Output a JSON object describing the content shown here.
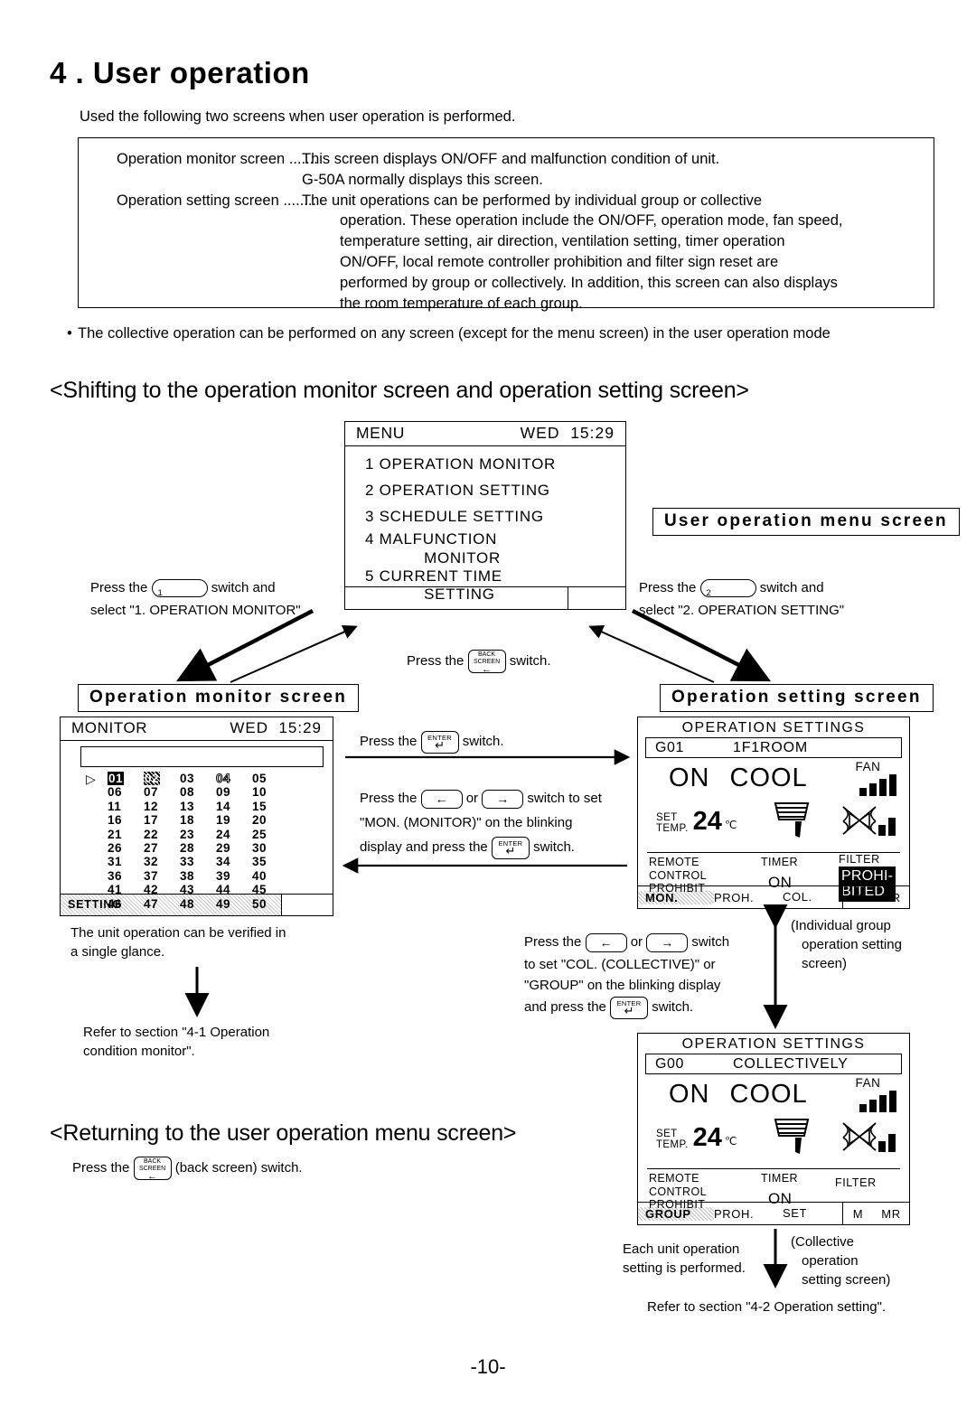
{
  "chapter": {
    "number": "4 .",
    "title": "User operation"
  },
  "intro": "Used the following two screens when user operation is performed.",
  "description_box": {
    "rows": [
      {
        "label": "Operation monitor screen .......",
        "text": "This screen displays ON/OFF and malfunction condition of unit."
      },
      {
        "label": "",
        "text": "G-50A normally displays  this screen."
      },
      {
        "label": "Operation setting screen ........",
        "text": "The unit operations can be performed by individual group or collective"
      }
    ],
    "continuation": [
      "operation. These operation include the ON/OFF, operation mode, fan speed,",
      "temperature setting, air direction, ventilation setting, timer operation",
      "ON/OFF, local remote controller prohibition and filter sign reset are",
      "performed by group or collectively. In addition, this screen can also displays",
      "the room temperature of each group."
    ]
  },
  "bullet": "The collective operation can be performed on any screen (except for the menu screen) in the user operation mode",
  "sections": {
    "shifting": "<Shifting to the operation monitor screen and operation setting screen>",
    "returning": "<Returning to the user operation menu screen>"
  },
  "menu_screen": {
    "title": "MENU",
    "day": "WED",
    "time": "15:29",
    "items": [
      "1 OPERATION MONITOR",
      "2 OPERATION SETTING",
      "3 SCHEDULE SETTING",
      "4 MALFUNCTION",
      "            MONITOR",
      "5 CURRENT TIME",
      "            SETTING"
    ]
  },
  "captions": {
    "user_menu": "User operation menu screen",
    "monitor": "Operation monitor screen",
    "setting": "Operation setting screen"
  },
  "instructions": {
    "press_1_line1": "Press the",
    "press_1_key": "1",
    "press_1_line1b": "switch and",
    "press_1_line2": "select \"1. OPERATION MONITOR\"",
    "press_2_line1": "Press the",
    "press_2_key": "2",
    "press_2_line1b": "switch and",
    "press_2_line2": "select \"2. OPERATION SETTING\"",
    "back_screen_press": "Press the",
    "back_screen_after": "switch.",
    "enter_press": "Press the",
    "enter_after": "switch.",
    "mon_line1a": "Press the",
    "mon_line1b": "or",
    "mon_line1c": "switch to set",
    "mon_line2": "\"MON. (MONITOR)\" on the blinking",
    "mon_line3a": "display and press the",
    "mon_line3b": "switch.",
    "col_line1a": "Press the",
    "col_line1b": "or",
    "col_line1c": "switch",
    "col_line2": "to set \"COL. (COLLECTIVE)\" or",
    "col_line3": "\"GROUP\" on the blinking display",
    "col_line4a": "and press the",
    "col_line4b": "switch.",
    "verify_l1": "The unit operation can be verified in",
    "verify_l2": "a single glance.",
    "refer41_l1": "Refer to section \"4-1 Operation",
    "refer41_l2": "condition monitor\".",
    "individual_note_l1": "(Individual group",
    "individual_note_l2": "operation setting",
    "individual_note_l3": "screen)",
    "collective_note_l1": "(Collective",
    "collective_note_l2": "operation",
    "collective_note_l3": "setting screen)",
    "each_unit_l1": "Each unit operation",
    "each_unit_l2": "setting is performed.",
    "refer42": "Refer to section \"4-2 Operation setting\".",
    "returning_press_a": "Press the",
    "returning_press_b": "(back screen) switch."
  },
  "keys": {
    "enter_label": "ENTER",
    "enter_symbol": "↵",
    "back_l1": "BACK",
    "back_l2": "SCREEN",
    "back_symbol": "←",
    "left_arrow": "←",
    "right_arrow": "→"
  },
  "monitor_screen": {
    "title": "MONITOR",
    "day": "WED",
    "time": "15:29",
    "caret": "▷",
    "cells": [
      {
        "v": "01",
        "style": "inv"
      },
      {
        "v": "02",
        "style": "hatch"
      },
      {
        "v": "03",
        "style": "plain"
      },
      {
        "v": "04",
        "style": "outline"
      },
      {
        "v": "05",
        "style": "plain"
      },
      {
        "v": "06",
        "style": "plain"
      },
      {
        "v": "07",
        "style": "plain"
      },
      {
        "v": "08",
        "style": "plain"
      },
      {
        "v": "09",
        "style": "plain"
      },
      {
        "v": "10",
        "style": "plain"
      },
      {
        "v": "11",
        "style": "plain"
      },
      {
        "v": "12",
        "style": "plain"
      },
      {
        "v": "13",
        "style": "plain"
      },
      {
        "v": "14",
        "style": "plain"
      },
      {
        "v": "15",
        "style": "plain"
      },
      {
        "v": "16",
        "style": "plain"
      },
      {
        "v": "17",
        "style": "plain"
      },
      {
        "v": "18",
        "style": "plain"
      },
      {
        "v": "19",
        "style": "plain"
      },
      {
        "v": "20",
        "style": "plain"
      },
      {
        "v": "21",
        "style": "plain"
      },
      {
        "v": "22",
        "style": "plain"
      },
      {
        "v": "23",
        "style": "plain"
      },
      {
        "v": "24",
        "style": "plain"
      },
      {
        "v": "25",
        "style": "plain"
      },
      {
        "v": "26",
        "style": "plain"
      },
      {
        "v": "27",
        "style": "plain"
      },
      {
        "v": "28",
        "style": "plain"
      },
      {
        "v": "29",
        "style": "plain"
      },
      {
        "v": "30",
        "style": "plain"
      },
      {
        "v": "31",
        "style": "plain"
      },
      {
        "v": "32",
        "style": "plain"
      },
      {
        "v": "33",
        "style": "plain"
      },
      {
        "v": "34",
        "style": "plain"
      },
      {
        "v": "35",
        "style": "plain"
      },
      {
        "v": "36",
        "style": "plain"
      },
      {
        "v": "37",
        "style": "plain"
      },
      {
        "v": "38",
        "style": "plain"
      },
      {
        "v": "39",
        "style": "plain"
      },
      {
        "v": "40",
        "style": "plain"
      },
      {
        "v": "41",
        "style": "plain"
      },
      {
        "v": "42",
        "style": "plain"
      },
      {
        "v": "43",
        "style": "plain"
      },
      {
        "v": "44",
        "style": "plain"
      },
      {
        "v": "45",
        "style": "plain"
      },
      {
        "v": "46",
        "style": "plain"
      },
      {
        "v": "47",
        "style": "plain"
      },
      {
        "v": "48",
        "style": "plain"
      },
      {
        "v": "49",
        "style": "plain"
      },
      {
        "v": "50",
        "style": "plain"
      }
    ],
    "footer_setting": "SETTING"
  },
  "ops_individual": {
    "header": "OPERATION  SETTINGS",
    "group_id": "G01",
    "group_name": "1F1ROOM",
    "power": "ON",
    "mode": "COOL",
    "fan_label": "FAN",
    "fan_bars": 4,
    "set_temp_label_1": "SET",
    "set_temp_label_2": "TEMP.",
    "set_temp_value": "24",
    "set_temp_unit": "℃",
    "vent_bars": 2,
    "remote_l1": "REMOTE",
    "remote_l2": "CONTROL",
    "remote_l3": "PROHIBIT",
    "timer_label": "TIMER",
    "timer_value": "ON",
    "filter_label": "FILTER",
    "filter_badge_l1": "PROHI-",
    "filter_badge_l2": "BITED",
    "footer": [
      "MON.",
      "PROH.",
      "COL.",
      "M",
      "MR"
    ]
  },
  "ops_collective": {
    "header": "OPERATION  SETTINGS",
    "group_id": "G00",
    "group_name": "COLLECTIVELY",
    "power": "ON",
    "mode": "COOL",
    "fan_label": "FAN",
    "fan_bars": 4,
    "set_temp_label_1": "SET",
    "set_temp_label_2": "TEMP.",
    "set_temp_value": "24",
    "set_temp_unit": "℃",
    "vent_bars": 2,
    "remote_l1": "REMOTE",
    "remote_l2": "CONTROL",
    "remote_l3": "PROHIBIT",
    "timer_label": "TIMER",
    "timer_value": "ON",
    "filter_label": "FILTER",
    "footer": [
      "GROUP",
      "PROH.",
      "SET",
      "M",
      "MR"
    ]
  },
  "page_number": "-10-"
}
